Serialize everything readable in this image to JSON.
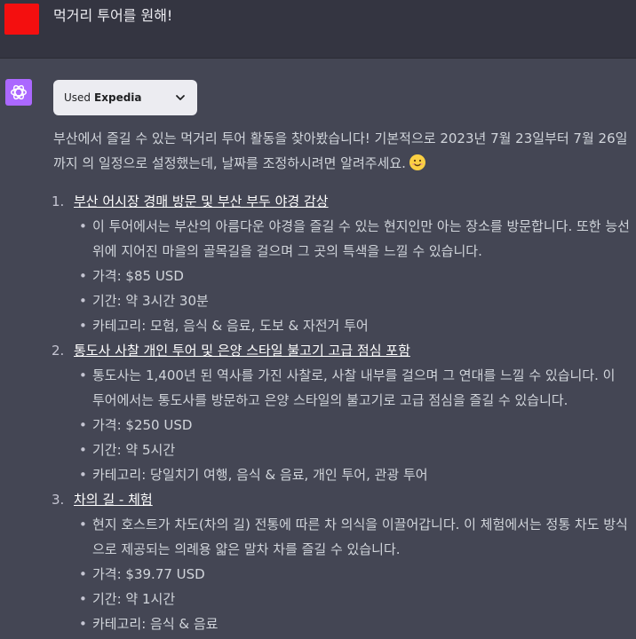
{
  "user": {
    "message": "먹거리 투어를 원해!"
  },
  "plugin": {
    "used_label": "Used",
    "name": "Expedia"
  },
  "assistant": {
    "intro": "부산에서 즐길 수 있는 먹거리 투어 활동을 찾아봤습니다! 기본적으로 2023년 7월 23일부터 7월 26일까지 의 일정으로 설정했는데, 날짜를 조정하시려면 알려주세요.",
    "tours": [
      {
        "number": "1.",
        "title": "부산 어시장 경매 방문 및 부산 부두 야경 감상",
        "description": "이 투어에서는 부산의 아름다운 야경을 즐길 수 있는 현지인만 아는 장소를 방문합니다. 또한 능선 위에 지어진 마을의 골목길을 걸으며 그 곳의 특색을 느낄 수 있습니다.",
        "price": "가격: $85 USD",
        "duration": "기간: 약 3시간 30분",
        "category": "카테고리: 모험, 음식 & 음료, 도보 & 자전거 투어"
      },
      {
        "number": "2.",
        "title": "통도사 사찰 개인 투어 및 은양 스타일 불고기 고급 점심 포함",
        "description": "통도사는 1,400년 된 역사를 가진 사찰로, 사찰 내부를 걸으며 그 연대를 느낄 수 있습니다. 이 투어에서는 통도사를 방문하고 은양 스타일의 불고기로 고급 점심을 즐길 수 있습니다.",
        "price": "가격: $250 USD",
        "duration": "기간: 약 5시간",
        "category": "카테고리: 당일치기 여행, 음식 & 음료, 개인 투어, 관광 투어"
      },
      {
        "number": "3.",
        "title": "차의 길 - 체험",
        "description": "현지 호스트가 차도(차의 길) 전통에 따른 차 의식을 이끌어갑니다. 이 체험에서는 정통 차도 방식으로 제공되는 의례용 얇은 말차 차를 즐길 수 있습니다.",
        "price": "가격: $39.77 USD",
        "duration": "기간: 약 1시간",
        "category": "카테고리: 음식 & 음료"
      }
    ]
  },
  "colors": {
    "user_avatar": "#f40f0f",
    "assistant_avatar": "#ab68ff",
    "background": "#444654"
  },
  "icons": {
    "assistant": "openai-logo-icon",
    "chevron": "chevron-down-icon",
    "emoji": "smiling-face-emoji-icon"
  }
}
